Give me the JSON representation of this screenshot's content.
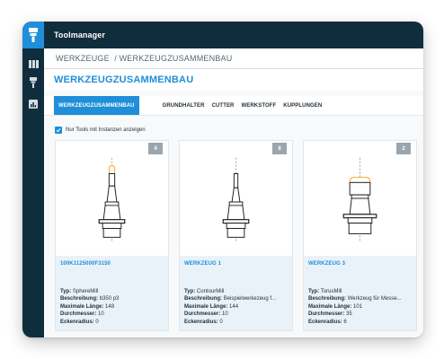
{
  "app": {
    "title": "Toolmanager"
  },
  "colors": {
    "accent": "#1e8fd8",
    "sidebar": "#0f2d3d",
    "highlight": "#f5a623",
    "badge": "#9aa6ae"
  },
  "sidebar": {
    "logo": "tool-logo-icon",
    "items": [
      {
        "icon": "library-icon"
      },
      {
        "icon": "tool-icon"
      },
      {
        "icon": "chart-icon"
      }
    ]
  },
  "breadcrumb": "WERKZEUGE  / WERKZEUGZUSAMMENBAU",
  "page_title": "WERKZEUGZUSAMMENBAU",
  "tabs": [
    {
      "label": "WERKZEUGZUSAMMENBAU",
      "active": true
    },
    {
      "label": "GRUNDHALTER",
      "active": false
    },
    {
      "label": "CUTTER",
      "active": false
    },
    {
      "label": "WERKSTOFF",
      "active": false
    },
    {
      "label": "KUPPLUNGEN",
      "active": false
    }
  ],
  "filter": {
    "label": "Nur Tools mit Instanzen anzeigen",
    "checked": true
  },
  "cards": [
    {
      "count": "4",
      "name": "100K1125000F3150",
      "tool_shape": "sphere-mill",
      "props": [
        {
          "label": "Typ:",
          "value": "SphereMill"
        },
        {
          "label": "Beschreibung:",
          "value": "b350 p3"
        },
        {
          "label": "Maximale Länge:",
          "value": "148"
        },
        {
          "label": "Durchmesser:",
          "value": "10"
        },
        {
          "label": "Eckenradius:",
          "value": "0"
        }
      ]
    },
    {
      "count": "8",
      "name": "WERKZEUG 1",
      "tool_shape": "contour-mill",
      "props": [
        {
          "label": "Typ:",
          "value": "ContourMill"
        },
        {
          "label": "Beschreibung:",
          "value": "Beispielwerkezeug f..."
        },
        {
          "label": "Maximale Länge:",
          "value": "144"
        },
        {
          "label": "Durchmesser:",
          "value": "10"
        },
        {
          "label": "Eckenradius:",
          "value": "0"
        }
      ]
    },
    {
      "count": "2",
      "name": "WERKZEUG 3",
      "tool_shape": "torus-mill",
      "props": [
        {
          "label": "Typ:",
          "value": "TorusMill"
        },
        {
          "label": "Beschreibung:",
          "value": "Werkzeug für Messe..."
        },
        {
          "label": "Maximale Länge:",
          "value": "101"
        },
        {
          "label": "Durchmesser:",
          "value": "35"
        },
        {
          "label": "Eckenradius:",
          "value": "6"
        }
      ]
    }
  ]
}
